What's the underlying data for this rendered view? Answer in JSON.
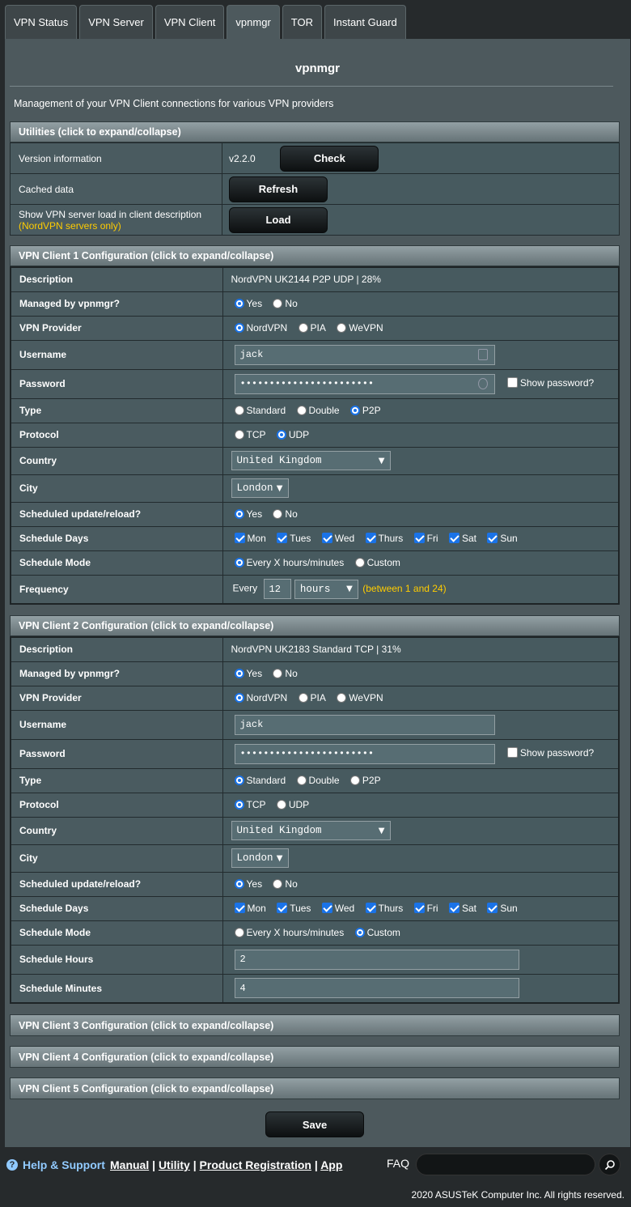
{
  "tabs": [
    "VPN Status",
    "VPN Server",
    "VPN Client",
    "vpnmgr",
    "TOR",
    "Instant Guard"
  ],
  "title": "vpnmgr",
  "subtitle": "Management of your VPN Client connections for various VPN providers",
  "utilities": {
    "header": "Utilities (click to expand/collapse)",
    "version_label": "Version information",
    "version_value": "v2.2.0",
    "check_label": "Check",
    "cached_label": "Cached data",
    "refresh_label": "Refresh",
    "load_desc": "Show VPN server load in client description",
    "load_note": "(NordVPN servers only)",
    "load_label": "Load"
  },
  "labels": {
    "description": "Description",
    "managed": "Managed by vpnmgr?",
    "provider": "VPN Provider",
    "username": "Username",
    "password": "Password",
    "type": "Type",
    "protocol": "Protocol",
    "country": "Country",
    "city": "City",
    "sched_update": "Scheduled update/reload?",
    "sched_days": "Schedule Days",
    "sched_mode": "Schedule Mode",
    "frequency": "Frequency",
    "sched_hours": "Schedule Hours",
    "sched_minutes": "Schedule Minutes"
  },
  "options": {
    "yes": "Yes",
    "no": "No",
    "nordvpn": "NordVPN",
    "pia": "PIA",
    "wevpn": "WeVPN",
    "show_password": "Show password?",
    "standard": "Standard",
    "double": "Double",
    "p2p": "P2P",
    "tcp": "TCP",
    "udp": "UDP",
    "mon": "Mon",
    "tues": "Tues",
    "wed": "Wed",
    "thurs": "Thurs",
    "fri": "Fri",
    "sat": "Sat",
    "sun": "Sun",
    "every_x": "Every X hours/minutes",
    "custom": "Custom",
    "every": "Every"
  },
  "client1": {
    "header": "VPN Client 1 Configuration (click to expand/collapse)",
    "description": "NordVPN UK2144 P2P UDP | 28%",
    "username": "jack",
    "password": "•••••••••••••••••••••••",
    "country": "United Kingdom",
    "city": "London",
    "freq_value": "12",
    "freq_unit": "hours",
    "freq_note": "(between 1 and 24)"
  },
  "client2": {
    "header": "VPN Client 2 Configuration (click to expand/collapse)",
    "description": "NordVPN UK2183 Standard TCP | 31%",
    "username": "jack",
    "password": "•••••••••••••••••••••••",
    "country": "United Kingdom",
    "city": "London",
    "hours": "2",
    "minutes": "4"
  },
  "collapsed": [
    "VPN Client 3 Configuration (click to expand/collapse)",
    "VPN Client 4 Configuration (click to expand/collapse)",
    "VPN Client 5 Configuration (click to expand/collapse)"
  ],
  "save_label": "Save",
  "footer": {
    "help": "Help & Support",
    "manual": "Manual",
    "utility": "Utility",
    "product_registration": "Product Registration",
    "app": "App",
    "faq": "FAQ",
    "copyright": "2020 ASUSTeK Computer Inc. All rights reserved."
  }
}
